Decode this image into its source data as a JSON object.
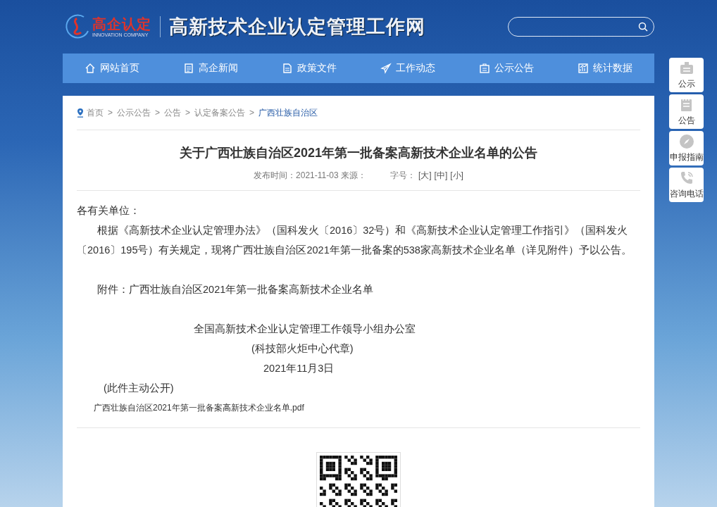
{
  "header": {
    "logo_text": "高企认定",
    "logo_subtext": "INNOVATION COMPANY",
    "site_title": "高新技术企业认定管理工作网"
  },
  "nav": [
    {
      "kind": "home",
      "label": "网站首页"
    },
    {
      "kind": "news",
      "label": "高企新闻"
    },
    {
      "kind": "doc",
      "label": "政策文件"
    },
    {
      "kind": "send",
      "label": "工作动态"
    },
    {
      "kind": "notice",
      "label": "公示公告"
    },
    {
      "kind": "chart",
      "label": "统计数据"
    }
  ],
  "side_buttons": [
    {
      "kind": "notice",
      "label": "公示"
    },
    {
      "kind": "board",
      "label": "公告"
    },
    {
      "kind": "compass",
      "label": "申报指南"
    },
    {
      "kind": "phone",
      "label": "咨询电话"
    }
  ],
  "breadcrumb": [
    {
      "label": "首页",
      "selected": false
    },
    {
      "sep": ">",
      "label": "公示公告",
      "selected": false
    },
    {
      "sep": ">",
      "label": "公告",
      "selected": false
    },
    {
      "sep": ">",
      "label": "认定备案公告",
      "selected": false
    },
    {
      "sep": ">",
      "label": "广西壮族自治区",
      "selected": true
    }
  ],
  "article": {
    "title": "关于广西壮族自治区2021年第一批备案高新技术企业名单的公告",
    "meta": {
      "published": "发布时间：2021-11-03 来源：",
      "font_size_label": "字号：",
      "font_sizes": [
        "[大]",
        "[中]",
        "[小]"
      ]
    },
    "paragraphs": [
      {
        "kind": "plain",
        "text": "各有关单位："
      },
      {
        "kind": "indent",
        "text": "根据《高新技术企业认定管理办法》（国科发火〔2016〕32号）和《高新技术企业认定管理工作指引》（国科发火〔2016〕195号）有关规定，现将广西壮族自治区2021年第一批备案的538家高新技术企业名单（详见附件）予以公告。"
      },
      {
        "kind": "gap"
      },
      {
        "kind": "indent",
        "text": "附件：广西壮族自治区2021年第一批备案高新技术企业名单"
      },
      {
        "kind": "gap"
      },
      {
        "kind": "sign",
        "text": "全国高新技术企业认定管理工作领导小组办公室"
      },
      {
        "kind": "sign2",
        "text": "(科技部火炬中心代章)"
      },
      {
        "kind": "sign3",
        "text": "2021年11月3日"
      },
      {
        "kind": "note",
        "text": "(此件主动公开)"
      },
      {
        "kind": "file",
        "text": "广西壮族自治区2021年第一批备案高新技术企业名单.pdf"
      }
    ]
  }
}
